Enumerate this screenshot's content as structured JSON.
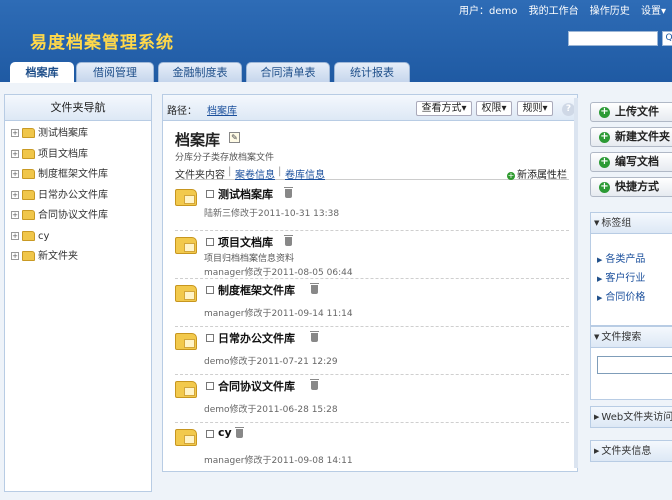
{
  "topbar": {
    "user_label": "用户：",
    "user_name": "demo",
    "workbench": "我的工作台",
    "history": "操作历史",
    "settings": "设置▾"
  },
  "app": {
    "title": "易度档案管理系统"
  },
  "search": {
    "button": "Q"
  },
  "tabs": [
    {
      "label": "档案库",
      "active": true
    },
    {
      "label": "借阅管理"
    },
    {
      "label": "金融制度表"
    },
    {
      "label": "合同清单表"
    },
    {
      "label": "统计报表"
    }
  ],
  "sidebar": {
    "title": "文件夹导航",
    "items": [
      {
        "label": "测试档案库"
      },
      {
        "label": "项目文档库"
      },
      {
        "label": "制度框架文件库"
      },
      {
        "label": "日常办公文件库"
      },
      {
        "label": "合同协议文件库"
      },
      {
        "label": "cy"
      },
      {
        "label": "新文件夹"
      }
    ]
  },
  "main": {
    "path_label": "路径：",
    "path_link": "档案库",
    "view_button": "查看方式▾",
    "perm_button": "权限▾",
    "rule_button": "规则▾",
    "help": "?",
    "title": "档案库",
    "edit_icon": "✎",
    "description": "分库分子类存放档案文件",
    "subtabs": {
      "content": "文件夹内容",
      "sep1": "|",
      "volume": "案卷信息",
      "sep2": "|",
      "volumes": "卷库信息",
      "add_prop_icon": "+",
      "add_prop": "新添属性栏"
    },
    "files": [
      {
        "name": "测试档案库",
        "desc": "",
        "modified": "陆新三修改于2011-10-31 13:38"
      },
      {
        "name": "项目文档库",
        "desc": "项目归档档案信息资料",
        "modified": "manager修改于2011-08-05 06:44"
      },
      {
        "name": "制度框架文件库",
        "desc": "",
        "modified": "manager修改于2011-09-14 11:14"
      },
      {
        "name": "日常办公文件库",
        "desc": "",
        "modified": "demo修改于2011-07-21 12:29"
      },
      {
        "name": "合同协议文件库",
        "desc": "",
        "modified": "demo修改于2011-06-28 15:28"
      },
      {
        "name": "cy",
        "desc": "",
        "modified": "manager修改于2011-09-08 14:11"
      }
    ]
  },
  "right": {
    "actions": [
      {
        "label": "上传文件",
        "icon": "+"
      },
      {
        "label": "新建文件夹",
        "icon": "+"
      },
      {
        "label": "编写文档",
        "icon": "+"
      },
      {
        "label": "快捷方式",
        "icon": "+"
      }
    ],
    "tri": "▼",
    "tags_title": "标签组",
    "tag_bullet": "▶",
    "tags": [
      {
        "label": "各类产品"
      },
      {
        "label": "客户行业"
      },
      {
        "label": "合同价格"
      }
    ],
    "search_title": "文件搜索",
    "web_access_title": "Web文件夹访问",
    "folder_info_title": "文件夹信息"
  }
}
